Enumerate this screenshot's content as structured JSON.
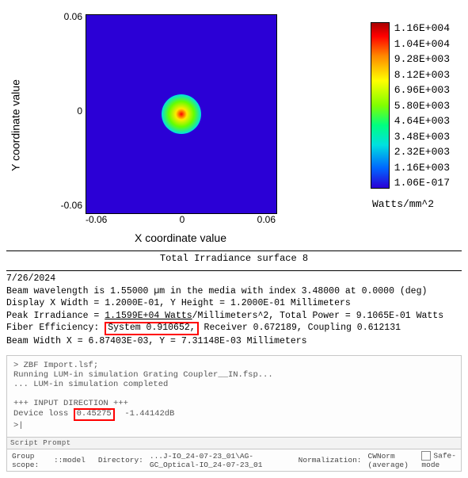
{
  "chart_data": {
    "type": "heatmap",
    "title": "",
    "xlabel": "X coordinate value",
    "ylabel": "Y coordinate value",
    "x_range": [
      -0.06,
      0.06
    ],
    "y_range": [
      -0.06,
      0.06
    ],
    "x_ticks": [
      "-0.06",
      "0",
      "0.06"
    ],
    "y_ticks": [
      "0.06",
      "0",
      "-0.06"
    ],
    "colorbar": {
      "unit": "Watts/mm^2",
      "ticks": [
        "1.16E+004",
        "1.04E+004",
        "9.28E+003",
        "8.12E+003",
        "6.96E+003",
        "5.80E+003",
        "4.64E+003",
        "3.48E+003",
        "2.32E+003",
        "1.16E+003",
        "1.06E-017"
      ]
    },
    "note": "Single Gaussian-like irradiance peak centered at (0,0); background near 0, peak ≈ 1.16E+004 W/mm^2"
  },
  "report": {
    "title": "Total Irradiance surface 8",
    "date": "7/26/2024",
    "line1_a": "Beam wavelength is 1.55000 µm in the media with index 3.48000 at 0.0000 (deg)",
    "line2_a": "Display X Width = 1.2000E-01, Y Height = 1.2000E-01 Millimeters",
    "line3_a": "Peak Irradiance = ",
    "line3_b": "1.1599E+04 Watts",
    "line3_c": "/Millimeters^2, Total Power = 9.1065E-01 Watts",
    "line4_a": "Fiber Efficiency: ",
    "line4_hl": "System 0.910652,",
    "line4_b": " Receiver 0.672189, Coupling 0.612131",
    "line5_a": "Beam Width X = 6.87403E-03, Y = 7.31148E-03 Millimeters"
  },
  "script": {
    "l1": "> ZBF Import.lsf;",
    "l2": "Running LUM-in simulation Grating Coupler__IN.fsp...",
    "l3": "... LUM-in simulation completed",
    "l4": "",
    "l5": "+++ INPUT DIRECTION +++",
    "l6a": "Device loss ",
    "l6hl": "0.45275",
    "l6b": "  -1.44142dB",
    "l7": ">|"
  },
  "status": {
    "prompt_label": "Script Prompt",
    "scope_label": "Group scope: ",
    "scope_value": "::model",
    "dir_label": "Directory: ",
    "dir_value": "...J-IO_24-07-23_01\\AG-GC_Optical-IO_24-07-23_01",
    "norm_label": "Normalization: ",
    "norm_value": "CWNorm (average)",
    "safe_label": "Safe-mode"
  }
}
